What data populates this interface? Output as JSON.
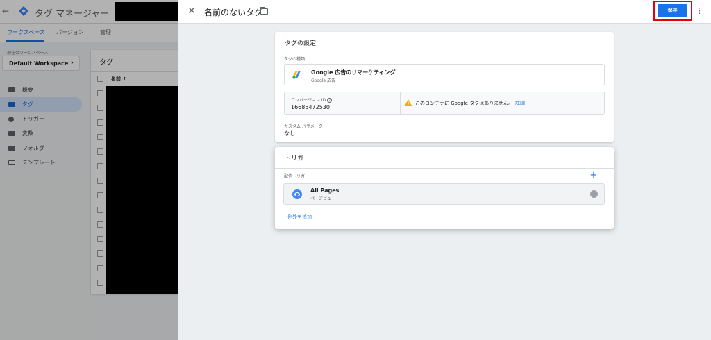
{
  "app": {
    "title": "タグ マネージャー",
    "tabs": [
      "ワークスペース",
      "バージョン",
      "管理"
    ],
    "workspace_label": "現在のワークスペース",
    "workspace_name": "Default Workspace",
    "nav": [
      "概要",
      "タグ",
      "トリガー",
      "変数",
      "フォルダ",
      "テンプレート"
    ],
    "tags_panel_title": "タグ",
    "tags_col_name": "名前 ↑"
  },
  "editor": {
    "title": "名前のないタグ",
    "save_label": "保存",
    "settings": {
      "title": "タグの設定",
      "tag_type_label": "タグの種類",
      "tag_type_name": "Google 広告のリマーケティング",
      "tag_type_sub": "Google 広告",
      "conversion_id_label": "コンバージョン ID",
      "conversion_id_value": "16685472530",
      "warning_text": "このコンテナに Google タグはありません。",
      "warning_link": "詳細",
      "custom_params_label": "カスタム パラメータ",
      "custom_params_value": "なし"
    },
    "trigger": {
      "title": "トリガー",
      "firing_label": "配信トリガー",
      "trigger_name": "All Pages",
      "trigger_type": "ページビュー",
      "add_exception": "例外を追加"
    }
  },
  "colors": {
    "primary": "#1a73e8",
    "highlight": "#e0000f",
    "warning": "#f9ab00"
  }
}
